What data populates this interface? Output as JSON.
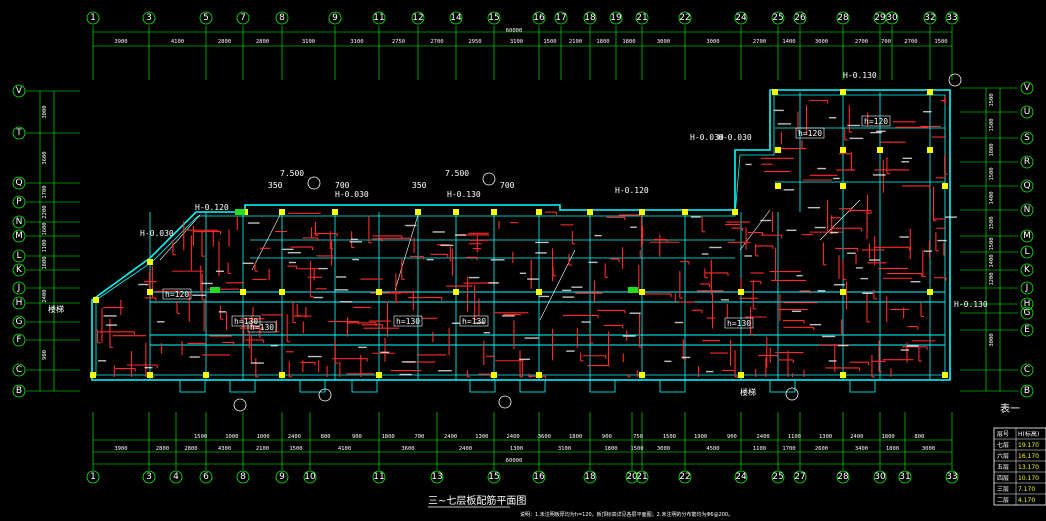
{
  "drawing": {
    "title": "三~七层板配筋平面图",
    "note": "说明：1.未注明板厚均为h=120，板顶标高详见各层平面图；2.未注明的分布筋均为Φ6@200。",
    "overall_top": "60000",
    "overall_bottom": "60000",
    "table_title": "表一",
    "colors": {
      "background": "#000000",
      "grid": "#00ff00",
      "wall": "#00ffff",
      "rebar": "#ff2a2a",
      "column": "#ffff00",
      "text": "#ffffff",
      "table_value": "#ffff00"
    }
  },
  "axes": {
    "top": [
      "1",
      "3",
      "5",
      "7",
      "8",
      "9",
      "11",
      "12",
      "14",
      "15",
      "16",
      "17",
      "18",
      "19",
      "21",
      "22",
      "24",
      "25",
      "26",
      "28",
      "29",
      "30",
      "32",
      "33"
    ],
    "bottom": [
      "1",
      "3",
      "4",
      "6",
      "8",
      "9",
      "10",
      "11",
      "13",
      "15",
      "16",
      "18",
      "20",
      "21",
      "22",
      "24",
      "25",
      "27",
      "28",
      "30",
      "31",
      "33"
    ],
    "left": [
      "V",
      "T",
      "Q",
      "P",
      "N",
      "M",
      "L",
      "K",
      "J",
      "H",
      "G",
      "F",
      "E",
      "D",
      "C",
      "B"
    ],
    "right": [
      "V",
      "U",
      "S",
      "R",
      "Q",
      "N",
      "M",
      "L",
      "K",
      "J",
      "H",
      "G",
      "E",
      "D",
      "C",
      "B"
    ]
  },
  "dims": {
    "top": [
      "3900",
      "4100",
      "2800",
      "2800",
      "3100",
      "3100",
      "2750",
      "2700",
      "2950",
      "3100",
      "1500",
      "2100",
      "1800",
      "1800",
      "3000",
      "3000",
      "2700",
      "1400",
      "3000",
      "2700",
      "700",
      "2700",
      "1500"
    ],
    "bottom": [
      "3900",
      "2800",
      "2800",
      "4300",
      "2100",
      "1500",
      "4100",
      "3600",
      "2400",
      "1300",
      "3100",
      "1800",
      "1500",
      "3000",
      "4500",
      "1100",
      "1700",
      "2600",
      "3400",
      "1800",
      "3000"
    ],
    "bottom_inner": [
      "1500",
      "1000",
      "1000",
      "2400",
      "800",
      "900",
      "1800",
      "700",
      "2400",
      "1300",
      "2400",
      "3600",
      "1800",
      "900",
      "750",
      "1500",
      "1900",
      "900",
      "2400",
      "1100",
      "1300",
      "2400",
      "1800",
      "800"
    ],
    "left": [
      "3000",
      "3600",
      "1700",
      "2200",
      "1600",
      "1100",
      "1800",
      "2400",
      "900"
    ],
    "right": [
      "1500",
      "1500",
      "1800",
      "1500",
      "1400",
      "1500",
      "1500",
      "1400",
      "1200",
      "3000"
    ]
  },
  "slab_labels": [
    "h=120",
    "h=130",
    "h=130",
    "h=130",
    "h=120",
    "h=130",
    "h=130",
    "h=120"
  ],
  "elevations": [
    "H-0.030",
    "H-0.120",
    "H-0.030",
    "H-0.130",
    "H-0.120",
    "H-0.030",
    "H-0.130",
    "H-0.030",
    "H-0.130"
  ],
  "annotations": [
    "7.500",
    "7.500",
    "350",
    "350",
    "700",
    "700",
    "楼梯",
    "楼梯"
  ],
  "table": {
    "headers": [
      "层号",
      "H(标高)"
    ],
    "rows": [
      [
        "七层",
        "19.170"
      ],
      [
        "六层",
        "16.170"
      ],
      [
        "五层",
        "13.170"
      ],
      [
        "四层",
        "10.170"
      ],
      [
        "三层",
        "7.170"
      ],
      [
        "二层",
        "4.170"
      ]
    ]
  }
}
